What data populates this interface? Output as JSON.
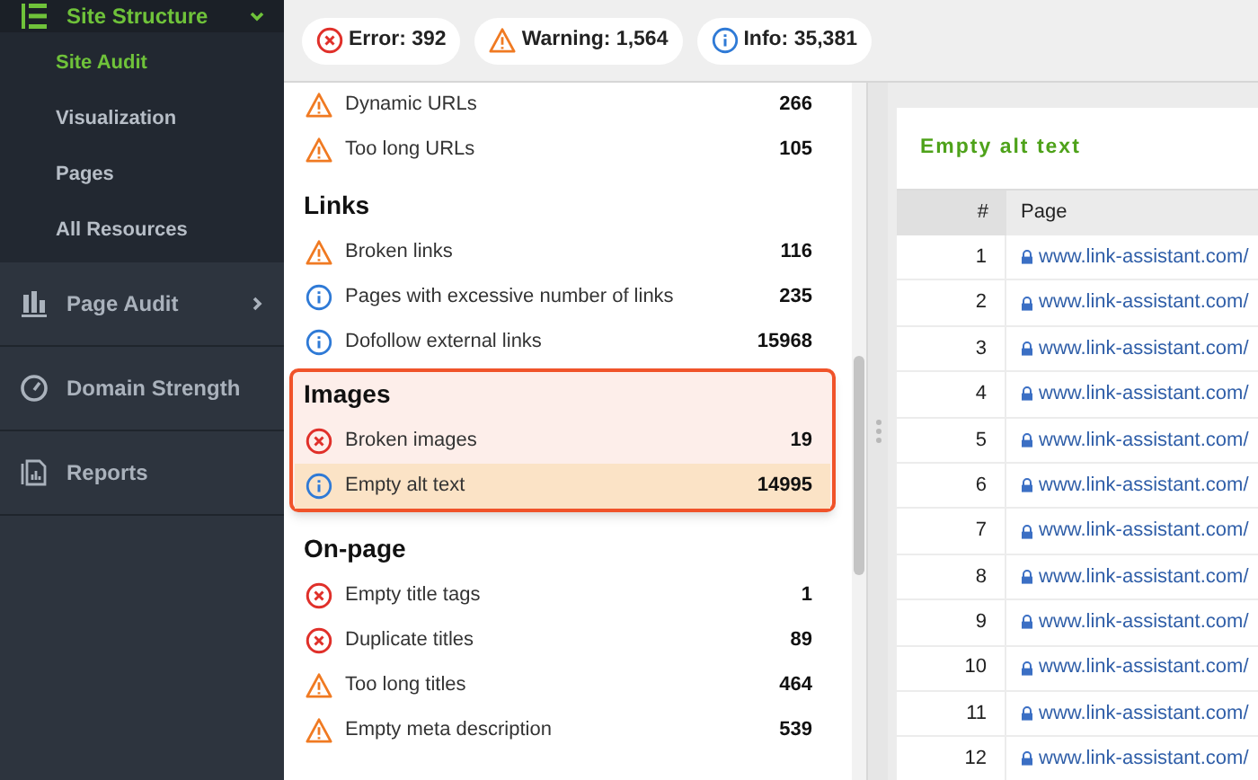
{
  "sidebar": {
    "sections": [
      {
        "label": "Site Structure",
        "expanded": true,
        "children": [
          {
            "label": "Site Audit",
            "selected": true
          },
          {
            "label": "Visualization",
            "selected": false
          },
          {
            "label": "Pages",
            "selected": false
          },
          {
            "label": "All Resources",
            "selected": false
          }
        ]
      },
      {
        "label": "Page Audit",
        "expanded": false
      },
      {
        "label": "Domain Strength"
      },
      {
        "label": "Reports"
      }
    ]
  },
  "summary": [
    {
      "kind": "error",
      "label": "Error: 392"
    },
    {
      "kind": "warning",
      "label": "Warning: 1,564"
    },
    {
      "kind": "info",
      "label": "Info: 35,381"
    }
  ],
  "issues": [
    {
      "highlighted": false,
      "items": [
        {
          "kind": "warning",
          "label": "Dynamic URLs",
          "count": "266",
          "selected": false
        },
        {
          "kind": "warning",
          "label": "Too long URLs",
          "count": "105",
          "selected": false
        }
      ]
    },
    {
      "title": "Links",
      "highlighted": false,
      "items": [
        {
          "kind": "warning",
          "label": "Broken links",
          "count": "116",
          "selected": false
        },
        {
          "kind": "info",
          "label": "Pages with excessive number of links",
          "count": "235",
          "selected": false
        },
        {
          "kind": "info",
          "label": "Dofollow external links",
          "count": "15968",
          "selected": false
        }
      ]
    },
    {
      "title": "Images",
      "highlighted": true,
      "items": [
        {
          "kind": "error",
          "label": "Broken images",
          "count": "19",
          "selected": false
        },
        {
          "kind": "info",
          "label": "Empty alt text",
          "count": "14995",
          "selected": true
        }
      ]
    },
    {
      "title": "On-page",
      "highlighted": false,
      "items": [
        {
          "kind": "error",
          "label": "Empty title tags",
          "count": "1",
          "selected": false
        },
        {
          "kind": "error",
          "label": "Duplicate titles",
          "count": "89",
          "selected": false
        },
        {
          "kind": "warning",
          "label": "Too long titles",
          "count": "464",
          "selected": false
        },
        {
          "kind": "warning",
          "label": "Empty meta description",
          "count": "539",
          "selected": false
        }
      ]
    }
  ],
  "detail": {
    "title": "Empty alt text",
    "columns": [
      "#",
      "Page"
    ],
    "rows": [
      [
        "1",
        "www.link-assistant.com/"
      ],
      [
        "2",
        "www.link-assistant.com/"
      ],
      [
        "3",
        "www.link-assistant.com/"
      ],
      [
        "4",
        "www.link-assistant.com/"
      ],
      [
        "5",
        "www.link-assistant.com/"
      ],
      [
        "6",
        "www.link-assistant.com/"
      ],
      [
        "7",
        "www.link-assistant.com/"
      ],
      [
        "8",
        "www.link-assistant.com/"
      ],
      [
        "9",
        "www.link-assistant.com/"
      ],
      [
        "10",
        "www.link-assistant.com/"
      ],
      [
        "11",
        "www.link-assistant.com/"
      ],
      [
        "12",
        "www.link-assistant.com/"
      ]
    ]
  }
}
